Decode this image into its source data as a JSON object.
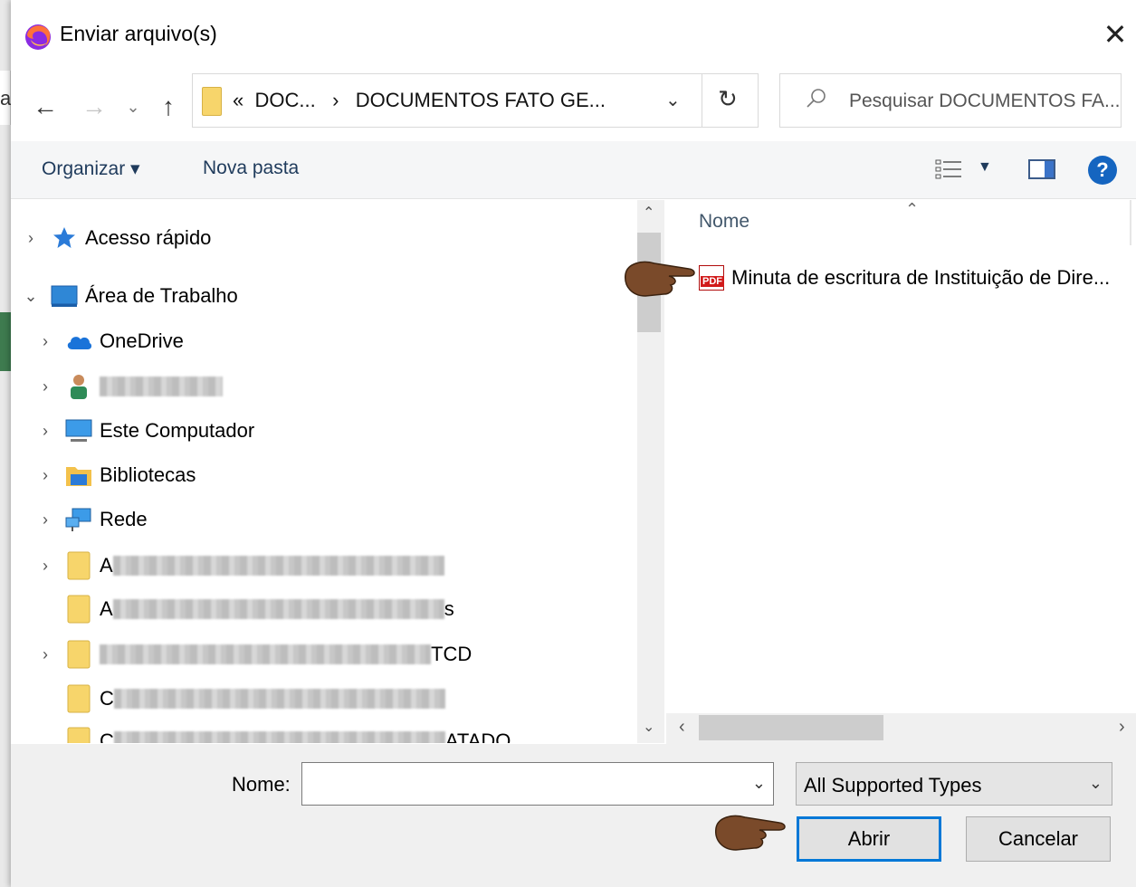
{
  "window": {
    "title": "Enviar arquivo(s)",
    "close_glyph": "✕"
  },
  "background": {
    "partial_letter": "a"
  },
  "nav": {
    "back": "←",
    "forward": "→",
    "recent": "⌄",
    "up": "↑",
    "address_prefix": "«",
    "address_parts": [
      "DOC...",
      "›",
      "DOCUMENTOS FATO GE..."
    ],
    "address_dropdown": "⌄",
    "refresh": "↻",
    "search_placeholder": "Pesquisar DOCUMENTOS FA..."
  },
  "toolbar": {
    "organize_label": "Organizar ▾",
    "new_folder_label": "Nova pasta",
    "help_label": "?"
  },
  "tree": [
    {
      "label": "Acesso rápido",
      "expanded": false,
      "icon": "star-icon"
    },
    {
      "label": "Área de Trabalho",
      "expanded": true,
      "icon": "desktop-icon"
    },
    {
      "label": "OneDrive",
      "expanded": false,
      "icon": "cloud-icon"
    },
    {
      "label": "",
      "expanded": false,
      "icon": "user-icon",
      "redacted": true
    },
    {
      "label": "Este Computador",
      "expanded": false,
      "icon": "computer-icon"
    },
    {
      "label": "Bibliotecas",
      "expanded": false,
      "icon": "library-icon"
    },
    {
      "label": "Rede",
      "expanded": false,
      "icon": "network-icon"
    },
    {
      "label": "A",
      "expanded": false,
      "icon": "folder-icon",
      "redacted": true
    },
    {
      "label": "A",
      "suffix": "s",
      "icon": "folder-icon",
      "redacted": true
    },
    {
      "label": "",
      "suffix": "TCD",
      "expanded": false,
      "icon": "folder-icon",
      "redacted": true
    },
    {
      "label": "C",
      "icon": "folder-icon",
      "redacted": true
    },
    {
      "label": "C",
      "suffix": "ATADO",
      "icon": "folder-icon",
      "redacted": true
    }
  ],
  "file_list": {
    "column_name": "Nome",
    "files": [
      {
        "name": "Minuta de escritura de Instituição de Dire...",
        "type_badge": "PDF",
        "icon": "pdf-icon"
      }
    ]
  },
  "bottom": {
    "name_label": "Nome:",
    "name_value": "",
    "file_type": "All Supported Types",
    "open_label": "Abrir",
    "cancel_label": "Cancelar"
  },
  "colors": {
    "accent": "#0078d7",
    "link_text": "#1f3b5c",
    "help": "#1565c0",
    "pdf": "#d11a1a"
  }
}
